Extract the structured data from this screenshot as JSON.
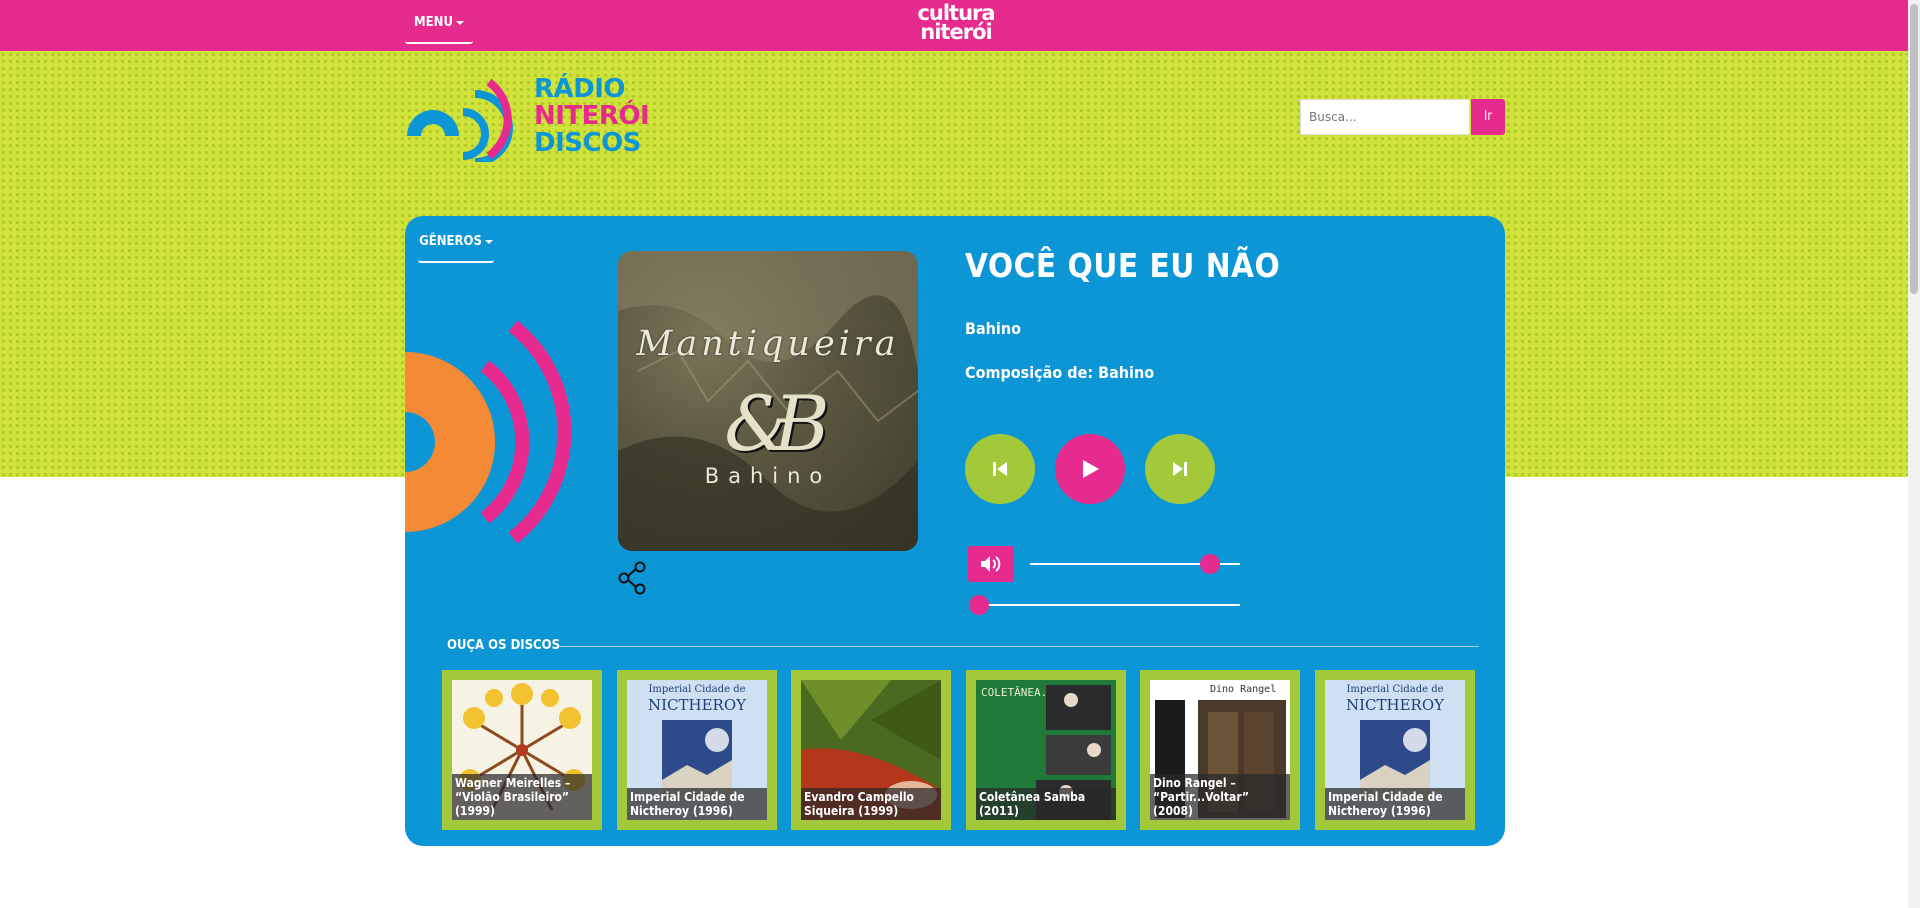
{
  "topbar": {
    "menu_label": "MENU",
    "brand_line1": "cultura",
    "brand_line2": "niterói",
    "color": "#e72a8e"
  },
  "header": {
    "logo_lines": [
      "RÁDIO",
      "NITERÓI",
      "DISCOS"
    ],
    "search": {
      "placeholder": "Busca...",
      "button_label": "Ir"
    }
  },
  "player": {
    "genres_label": "GÊNEROS",
    "cover": {
      "title": "Mantiqueira",
      "monogram": "&B",
      "artist": "Bahino"
    },
    "song_title": "VOCÊ QUE EU NÃO",
    "artist": "Bahino",
    "composer": "Composição de: Bahino",
    "controls": {
      "prev_icon": "skip-previous-icon",
      "play_icon": "play-icon",
      "next_icon": "skip-next-icon",
      "volume_icon": "volume-icon",
      "share_icon": "share-icon"
    },
    "volume_level": 0.8,
    "progress": 0.0
  },
  "discos": {
    "heading": "OUÇA OS DISCOS",
    "items": [
      {
        "caption": "Wagner Meirelles – “Violão Brasileiro” (1999)"
      },
      {
        "caption": "Imperial Cidade de Nictheroy (1996)",
        "art_text_1": "Imperial Cidade de",
        "art_text_2": "NICTHEROY"
      },
      {
        "caption": "Evandro Campello Siqueira (1999)"
      },
      {
        "caption": "Coletânea Samba (2011)",
        "art_text_1": "COLETÂNEA."
      },
      {
        "caption": "Dino Rangel – “Partir...Voltar” (2008)",
        "art_text_1": "Dino Rangel"
      },
      {
        "caption": "Imperial Cidade de Nictheroy (1996)",
        "art_text_1": "Imperial Cidade de",
        "art_text_2": "NICTHEROY"
      }
    ]
  },
  "colors": {
    "pink": "#e72a8e",
    "blue": "#0d96d6",
    "lime": "#cfe33a",
    "green": "#a3c93a",
    "orange": "#f58a36"
  }
}
